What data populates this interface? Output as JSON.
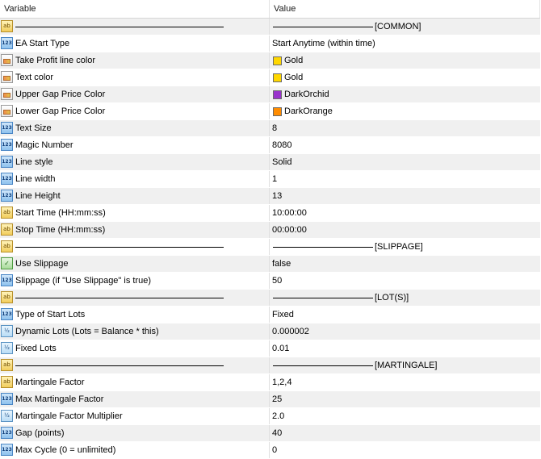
{
  "header": {
    "variable": "Variable",
    "value": "Value"
  },
  "rows": [
    {
      "icon": "ab",
      "icon_name": "string-icon",
      "type": "sep",
      "value": "[COMMON]"
    },
    {
      "icon": "123",
      "icon_name": "integer-icon",
      "name": "EA Start Type",
      "value": "Start Anytime (within time)"
    },
    {
      "icon": "col",
      "icon_name": "color-icon",
      "name": "Take Profit line color",
      "value": "Gold",
      "color": "#ffd700"
    },
    {
      "icon": "col",
      "icon_name": "color-icon",
      "name": "Text color",
      "value": "Gold",
      "color": "#ffd700"
    },
    {
      "icon": "col",
      "icon_name": "color-icon",
      "name": "Upper Gap Price Color",
      "value": "DarkOrchid",
      "color": "#9932cc"
    },
    {
      "icon": "col",
      "icon_name": "color-icon",
      "name": "Lower Gap Price Color",
      "value": "DarkOrange",
      "color": "#ff8c00"
    },
    {
      "icon": "123",
      "icon_name": "integer-icon",
      "name": "Text Size",
      "value": "8"
    },
    {
      "icon": "123",
      "icon_name": "integer-icon",
      "name": "Magic Number",
      "value": "8080"
    },
    {
      "icon": "123",
      "icon_name": "integer-icon",
      "name": "Line style",
      "value": "Solid"
    },
    {
      "icon": "123",
      "icon_name": "integer-icon",
      "name": "Line width",
      "value": "1"
    },
    {
      "icon": "123",
      "icon_name": "integer-icon",
      "name": "Line Height",
      "value": "13"
    },
    {
      "icon": "ab",
      "icon_name": "string-icon",
      "name": "Start Time (HH:mm:ss)",
      "value": "10:00:00"
    },
    {
      "icon": "ab",
      "icon_name": "string-icon",
      "name": "Stop Time (HH:mm:ss)",
      "value": "00:00:00"
    },
    {
      "icon": "ab",
      "icon_name": "string-icon",
      "type": "sep",
      "value": "[SLIPPAGE]"
    },
    {
      "icon": "bool",
      "icon_name": "boolean-icon",
      "name": "Use Slippage",
      "value": "false"
    },
    {
      "icon": "123",
      "icon_name": "integer-icon",
      "name": "Slippage (if \"Use Slippage\" is true)",
      "value": "50"
    },
    {
      "icon": "ab",
      "icon_name": "string-icon",
      "type": "sep",
      "value": "[LOT(S)]"
    },
    {
      "icon": "123",
      "icon_name": "integer-icon",
      "name": "Type of Start Lots",
      "value": "Fixed"
    },
    {
      "icon": "dbl",
      "icon_name": "double-icon",
      "name": "Dynamic Lots (Lots = Balance * this)",
      "value": "0.000002"
    },
    {
      "icon": "dbl",
      "icon_name": "double-icon",
      "name": "Fixed Lots",
      "value": "0.01"
    },
    {
      "icon": "ab",
      "icon_name": "string-icon",
      "type": "sep",
      "value": "[MARTINGALE]"
    },
    {
      "icon": "ab",
      "icon_name": "string-icon",
      "name": "Martingale Factor",
      "value": "1,2,4"
    },
    {
      "icon": "123",
      "icon_name": "integer-icon",
      "name": "Max Martingale Factor",
      "value": "25"
    },
    {
      "icon": "dbl",
      "icon_name": "double-icon",
      "name": "Martingale Factor Multiplier",
      "value": "2.0"
    },
    {
      "icon": "123",
      "icon_name": "integer-icon",
      "name": "Gap (points)",
      "value": "40"
    },
    {
      "icon": "123",
      "icon_name": "integer-icon",
      "name": "Max Cycle (0 = unlimited)",
      "value": "0"
    }
  ]
}
